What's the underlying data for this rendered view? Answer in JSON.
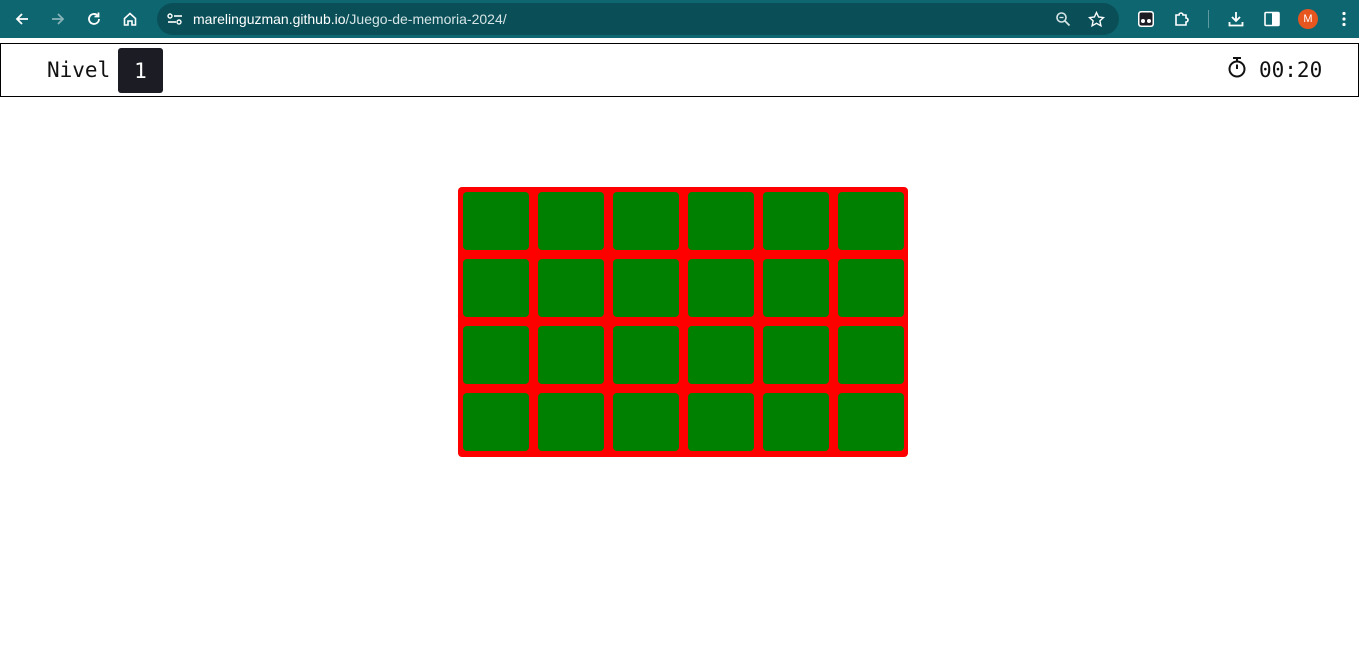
{
  "browser": {
    "url_host": "marelinguzman.github.io",
    "url_path": "/Juego-de-memoria-2024/",
    "profile_initial": "M",
    "icons": [
      "back-icon",
      "forward-icon",
      "reload-icon",
      "home-icon",
      "site-info-icon",
      "zoom-icon",
      "star-icon",
      "extension-icon",
      "puzzle-icon",
      "download-icon",
      "side-panel-icon",
      "menu-icon"
    ]
  },
  "game": {
    "level_label": "Nivel",
    "level_value": "1",
    "timer_icon": "stopwatch-icon",
    "timer": "00:20",
    "board": {
      "rows": 4,
      "columns": 6,
      "card_count": 24,
      "background_color": "#ff0000",
      "card_color": "#008000"
    }
  }
}
